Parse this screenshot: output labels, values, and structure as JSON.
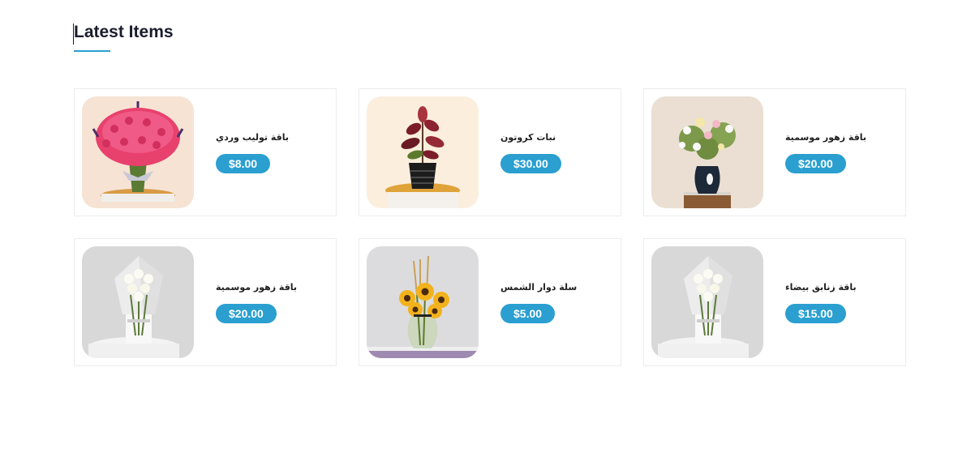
{
  "section": {
    "title": "Latest Items"
  },
  "colors": {
    "accent": "#2a9fd0",
    "title": "#1b1d2e",
    "card_border": "#ececec"
  },
  "items": [
    {
      "name": "باقة توليب وردي",
      "price": "$8.00",
      "image": "pink-tulip-bouquet"
    },
    {
      "name": "نبات كروتون",
      "price": "$30.00",
      "image": "croton-plant-pot"
    },
    {
      "name": "باقة زهور موسمية",
      "price": "$20.00",
      "image": "seasonal-flowers-vase"
    },
    {
      "name": "باقة زهور موسمية",
      "price": "$20.00",
      "image": "white-flower-bouquet"
    },
    {
      "name": "سلة دوار الشمس",
      "price": "$5.00",
      "image": "sunflower-vase"
    },
    {
      "name": "باقة زنابق بيضاء",
      "price": "$15.00",
      "image": "white-lilies-bouquet"
    }
  ]
}
